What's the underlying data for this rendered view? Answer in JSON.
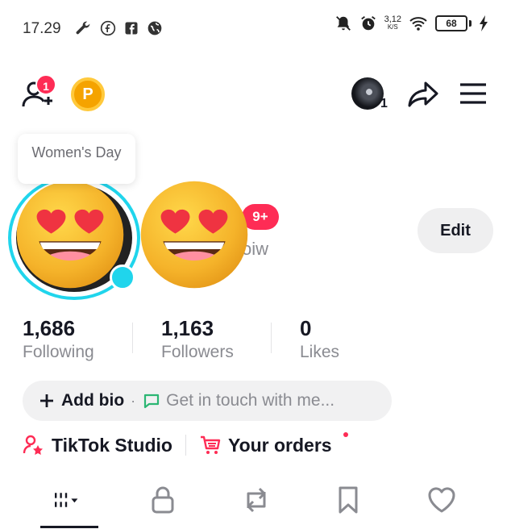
{
  "status_bar": {
    "time": "17.29",
    "net_speed_value": "3,12",
    "net_speed_unit": "K/S",
    "battery": "68",
    "icons": [
      "wrench-icon",
      "facebook-circle-icon",
      "facebook-square-icon",
      "globe-icon",
      "bell-off-icon",
      "alarm-icon",
      "wifi-icon",
      "charging-icon"
    ]
  },
  "top_nav": {
    "add_friend_badge": "1",
    "coin_letter": "P",
    "account_count": "1"
  },
  "tooltip": {
    "text": "Women's Day"
  },
  "profile": {
    "messages_badge": "9+",
    "username_fragment": "oiw",
    "edit_label": "Edit"
  },
  "stats": [
    {
      "value": "1,686",
      "label": "Following"
    },
    {
      "value": "1,163",
      "label": "Followers"
    },
    {
      "value": "0",
      "label": "Likes"
    }
  ],
  "bio": {
    "add_bio_label": "Add bio",
    "separator": "·",
    "contact_label": "Get in touch with me..."
  },
  "tools": {
    "studio_label": "TikTok Studio",
    "orders_label": "Your orders"
  },
  "tabs": [
    "videos-grid",
    "private",
    "reposts",
    "favorites",
    "liked"
  ],
  "colors": {
    "accent_red": "#fe2c55",
    "ring_cyan": "#20d5ec",
    "coin_gold": "#f5a300",
    "text_primary": "#161823",
    "text_secondary": "#8a8b91"
  }
}
